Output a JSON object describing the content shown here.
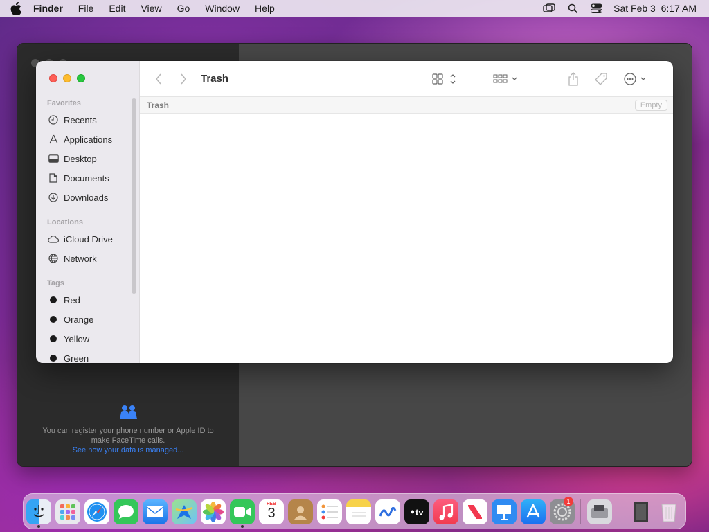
{
  "menubar": {
    "app_name": "Finder",
    "items": [
      "File",
      "Edit",
      "View",
      "Go",
      "Window",
      "Help"
    ],
    "clock": "Sat Feb 3  6:17 AM"
  },
  "facetime": {
    "info_line1": "You can register your phone number or Apple ID to",
    "info_line2": "make FaceTime calls.",
    "info_link": "See how your data is managed..."
  },
  "finder": {
    "title": "Trash",
    "path_label": "Trash",
    "empty_button": "Empty",
    "sidebar": {
      "favorites_header": "Favorites",
      "favorites": [
        {
          "label": "Recents",
          "icon": "clock-icon"
        },
        {
          "label": "Applications",
          "icon": "applications-icon"
        },
        {
          "label": "Desktop",
          "icon": "desktop-icon"
        },
        {
          "label": "Documents",
          "icon": "document-icon"
        },
        {
          "label": "Downloads",
          "icon": "download-icon"
        }
      ],
      "locations_header": "Locations",
      "locations": [
        {
          "label": "iCloud Drive",
          "icon": "cloud-icon"
        },
        {
          "label": "Network",
          "icon": "globe-icon"
        }
      ],
      "tags_header": "Tags",
      "tags": [
        {
          "label": "Red"
        },
        {
          "label": "Orange"
        },
        {
          "label": "Yellow"
        },
        {
          "label": "Green"
        }
      ]
    }
  },
  "dock": {
    "calendar_month": "FEB",
    "calendar_day": "3",
    "tv_label": "tv",
    "settings_badge": "1"
  },
  "colors": {
    "close": "#fe5f57",
    "minimize": "#febc2e",
    "zoom": "#28c840",
    "accent": "#3a82f7"
  }
}
